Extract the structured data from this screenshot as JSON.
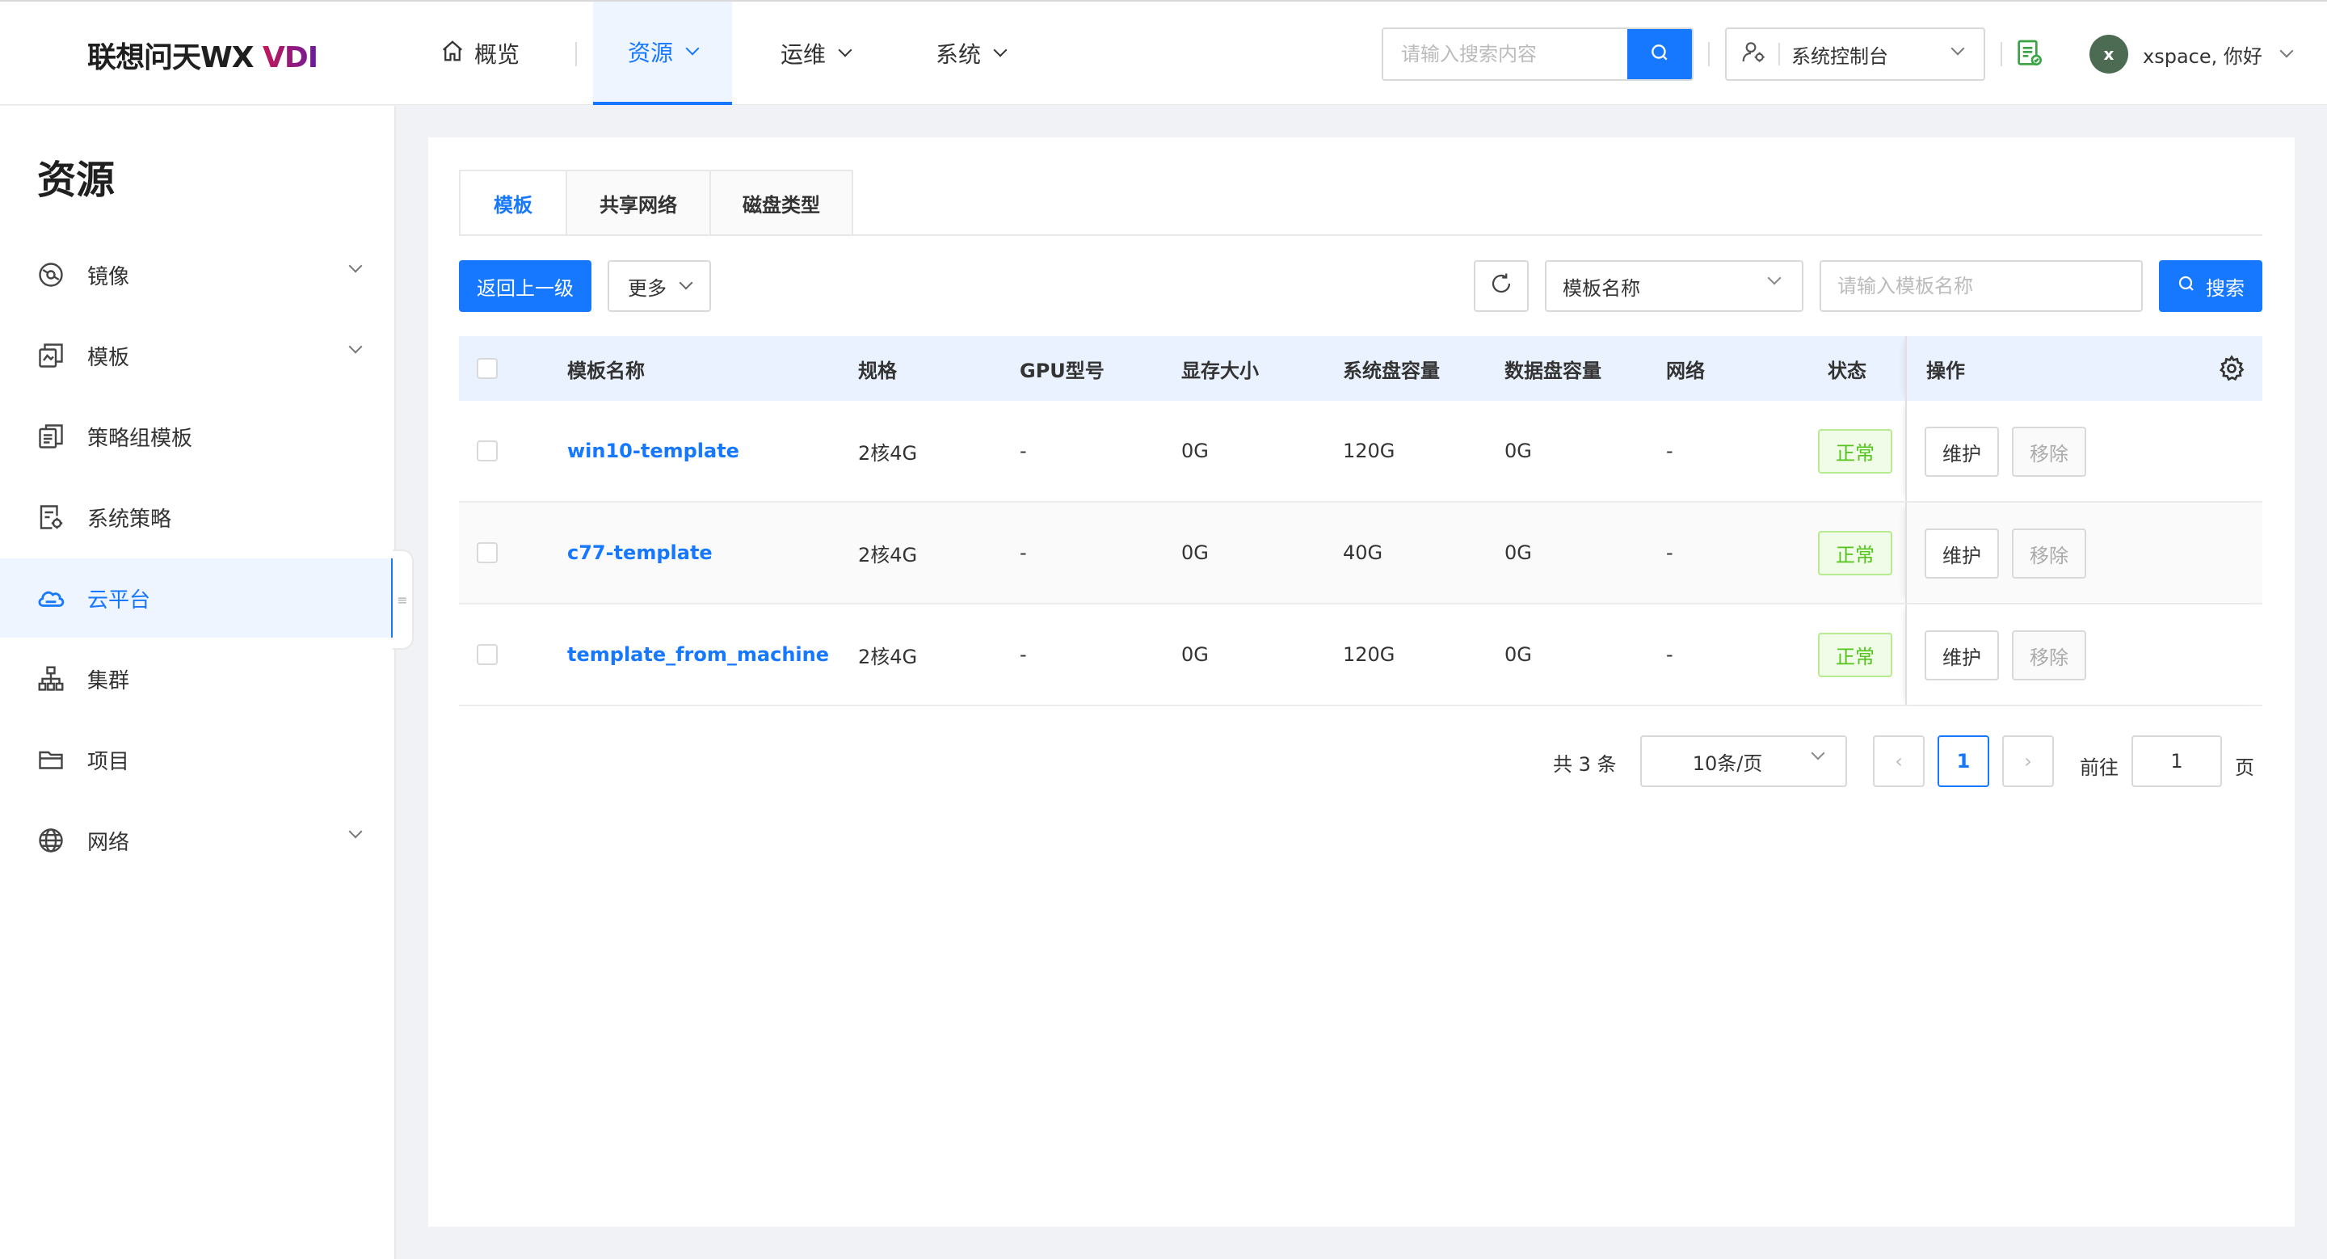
{
  "header": {
    "logo_main": "联想问天WX ",
    "logo_accent": "VDI",
    "nav": {
      "overview": "概览",
      "resources": "资源",
      "ops": "运维",
      "system": "系统"
    },
    "search_placeholder": "请输入搜索内容",
    "console_label": "系统控制台",
    "user_initial": "x",
    "user_greeting": "xspace, 你好"
  },
  "sidebar": {
    "title": "资源",
    "items": [
      {
        "label": "镜像",
        "icon": "image-disc-icon"
      },
      {
        "label": "模板",
        "icon": "template-icon"
      },
      {
        "label": "策略组模板",
        "icon": "policy-group-icon"
      },
      {
        "label": "系统策略",
        "icon": "system-policy-icon"
      },
      {
        "label": "云平台",
        "icon": "cloud-icon"
      },
      {
        "label": "集群",
        "icon": "cluster-icon"
      },
      {
        "label": "项目",
        "icon": "folder-icon"
      },
      {
        "label": "网络",
        "icon": "globe-icon"
      }
    ]
  },
  "tabs": [
    "模板",
    "共享网络",
    "磁盘类型"
  ],
  "toolbar": {
    "back_label": "返回上一级",
    "more_label": "更多",
    "filter_field": "模板名称",
    "filter_placeholder": "请输入模板名称",
    "search_label": "搜索"
  },
  "table": {
    "columns": {
      "name": "模板名称",
      "spec": "规格",
      "gpu": "GPU型号",
      "vram": "显存大小",
      "sys_disk": "系统盘容量",
      "data_disk": "数据盘容量",
      "network": "网络",
      "status": "状态",
      "ops": "操作"
    },
    "rows": [
      {
        "name": "win10-template",
        "spec": "2核4G",
        "gpu": "-",
        "vram": "0G",
        "sys_disk": "120G",
        "data_disk": "0G",
        "network": "-",
        "status": "正常",
        "maintain": "维护",
        "remove": "移除"
      },
      {
        "name": "c77-template",
        "spec": "2核4G",
        "gpu": "-",
        "vram": "0G",
        "sys_disk": "40G",
        "data_disk": "0G",
        "network": "-",
        "status": "正常",
        "maintain": "维护",
        "remove": "移除"
      },
      {
        "name": "template_from_machine",
        "spec": "2核4G",
        "gpu": "-",
        "vram": "0G",
        "sys_disk": "120G",
        "data_disk": "0G",
        "network": "-",
        "status": "正常",
        "maintain": "维护",
        "remove": "移除"
      }
    ]
  },
  "pagination": {
    "total": "共 3 条",
    "page_size": "10条/页",
    "current_page": "1",
    "goto_label": "前往",
    "goto_value": "1",
    "page_suffix": "页"
  },
  "colors": {
    "primary": "#1677ff",
    "success": "#52c41a",
    "avatar": "#4c6b52"
  }
}
